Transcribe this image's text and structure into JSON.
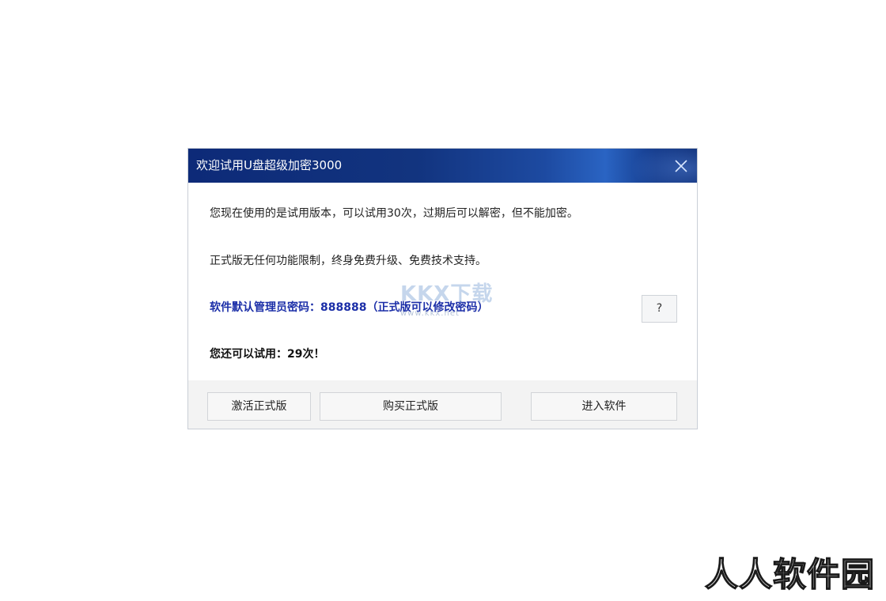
{
  "dialog": {
    "title": "欢迎试用U盘超级加密3000",
    "close_icon": "close-icon",
    "lines": {
      "trial_info": "您现在使用的是试用版本，可以试用30次，过期后可以解密，但不能加密。",
      "full_version_info": "正式版无任何功能限制，终身免费升级、免费技术支持。",
      "admin_password": "软件默认管理员密码：888888（正式版可以修改密码）",
      "remaining": "您还可以试用：29次！"
    },
    "help_button": "?",
    "buttons": {
      "activate": "激活正式版",
      "buy": "购买正式版",
      "enter": "进入软件"
    }
  },
  "watermark": {
    "main": "KKX下载",
    "url": "www.kkx.net"
  },
  "corner_watermark": "人人软件园",
  "colors": {
    "titlebar": "#0d2a78",
    "password_text": "#1c2fa8",
    "footer_bg": "#f3f3f3"
  }
}
